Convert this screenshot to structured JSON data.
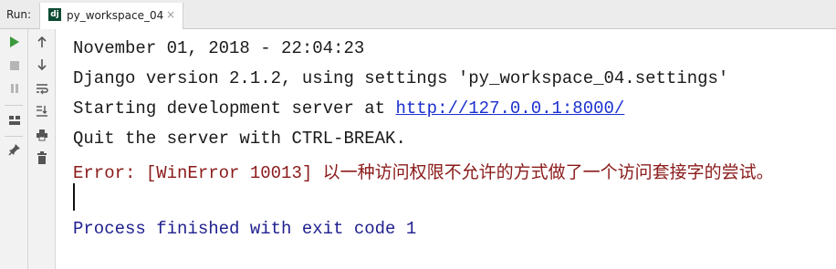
{
  "run_panel": {
    "label": "Run:",
    "tab": {
      "icon_text": "dj",
      "title": "py_workspace_04",
      "close_glyph": "×"
    }
  },
  "toolbar": {
    "left": [
      {
        "name": "rerun-icon",
        "color": "#3c9a3c"
      },
      {
        "name": "stop-icon",
        "color": "#b5b5b5"
      },
      {
        "name": "pause-icon",
        "color": "#b5b5b5"
      },
      {
        "name": "layout-icon",
        "color": "#555555"
      },
      {
        "name": "pin-icon",
        "color": "#555555"
      }
    ],
    "right": [
      {
        "name": "up-arrow-icon"
      },
      {
        "name": "down-arrow-icon"
      },
      {
        "name": "soft-wrap-icon"
      },
      {
        "name": "scroll-to-end-icon"
      },
      {
        "name": "print-icon"
      },
      {
        "name": "trash-icon"
      }
    ]
  },
  "console": {
    "lines": [
      "November 01, 2018 - 22:04:23",
      "Django version 2.1.2, using settings 'py_workspace_04.settings'",
      "Starting development server at ",
      "Quit the server with CTRL-BREAK.",
      "Error: [WinError 10013] 以一种访问权限不允许的方式做了一个访问套接字的尝试。",
      "Process finished with exit code 1"
    ],
    "server_url": "http://127.0.0.1:8000/"
  },
  "colors": {
    "error": "#8b1a1a",
    "exit": "#1f1f8f",
    "link": "#1a2fcf"
  }
}
